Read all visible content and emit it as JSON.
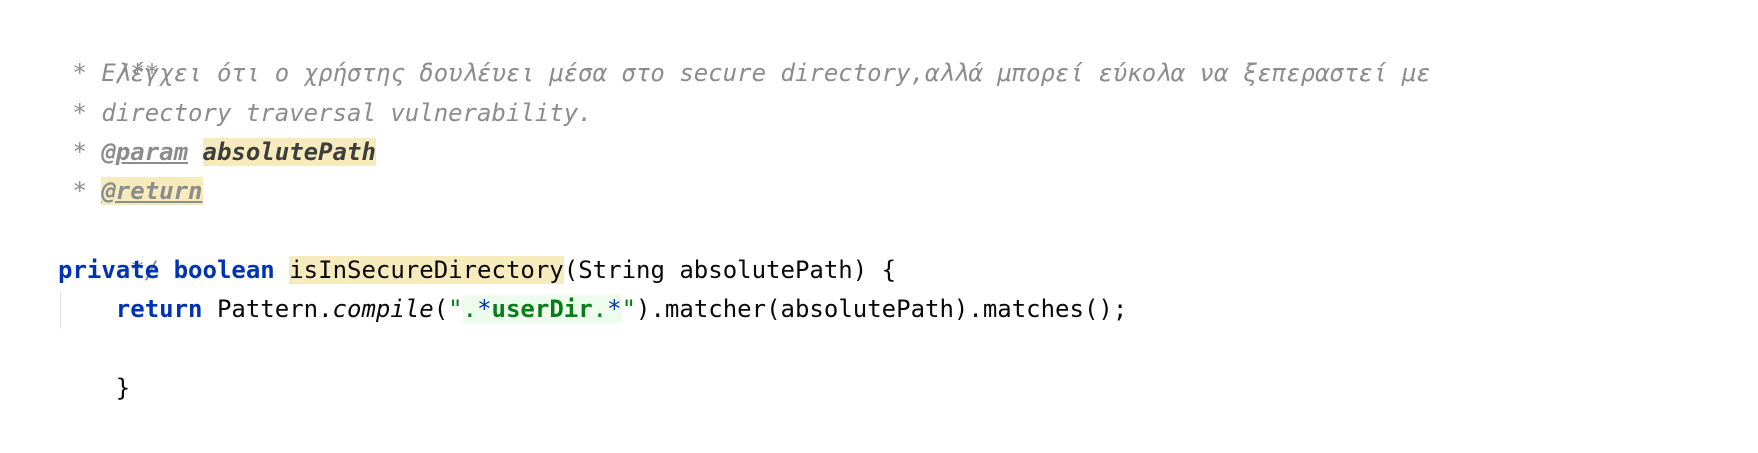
{
  "code": {
    "doc_open": "/**",
    "doc_line1_prefix": " * ",
    "doc_line1_text": "Ελέγχει ότι ο χρήστης δουλέυει μέσα στο secure directory,αλλά μπορεί εύκολα να ξεπεραστεί με",
    "doc_line2_prefix": " * ",
    "doc_line2_text": "directory traversal vulnerability.",
    "doc_param_prefix": " * ",
    "doc_param_tag": "@param",
    "doc_param_space": " ",
    "doc_param_name": "absolutePath",
    "doc_return_prefix": " * ",
    "doc_return_tag": "@return",
    "doc_close": " */",
    "sig_kw_private": "private",
    "sig_sp1": " ",
    "sig_kw_boolean": "boolean",
    "sig_sp2": " ",
    "sig_method_name": "isInSecureDirectory",
    "sig_params": "(String absolutePath) {",
    "body_indent": "    ",
    "body_kw_return": "return",
    "body_pattern": " Pattern.",
    "body_compile": "compile",
    "body_open_paren": "(",
    "body_quote_open": "\"",
    "body_regex_dot1": ".",
    "body_regex_star1": "*",
    "body_regex_literal": "userDir",
    "body_regex_dot2": ".",
    "body_regex_star2": "*",
    "body_quote_close": "\"",
    "body_rest": ").matcher(absolutePath).matches();",
    "close_brace": "}"
  }
}
